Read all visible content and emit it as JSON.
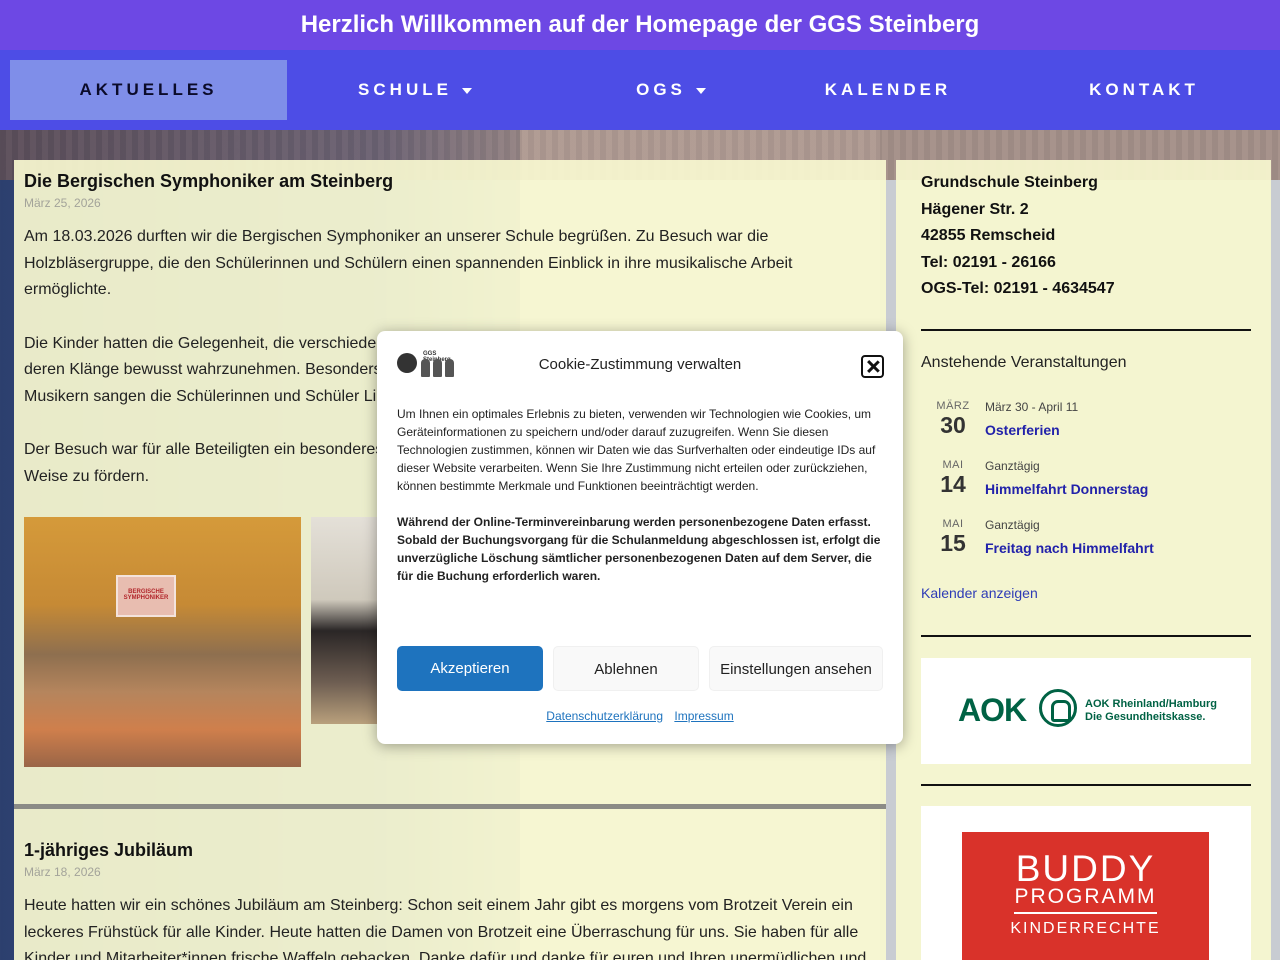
{
  "header": {
    "title": "Herzlich Willkommen auf der Homepage der GGS Steinberg"
  },
  "nav": {
    "items": [
      {
        "label": "AKTUELLES"
      },
      {
        "label": "SCHULE"
      },
      {
        "label": "OGS"
      },
      {
        "label": "KALENDER"
      },
      {
        "label": "KONTAKT"
      }
    ]
  },
  "posts": [
    {
      "title": "Die Bergischen Symphoniker am Steinberg",
      "date": "März 25, 2026",
      "paragraphs": [
        "Am 18.03.2026 durften wir die Bergischen Symphoniker an unserer Schule begrüßen. Zu Besuch war die Holzbläsergruppe, die den Schülerinnen und Schülern einen spannenden Einblick in ihre musikalische Arbeit ermöglichte.",
        "Die Kinder hatten die Gelegenheit, die verschiede",
        "deren Klänge bewusst wahrzunehmen. Besonders",
        "Musikern sangen die Schülerinnen und Schüler Li",
        "Der Besuch war für alle Beteiligten ein besonderes",
        "Weise zu fördern."
      ],
      "photo_caption": "BERGISCHE SYMPHONIKER"
    },
    {
      "title": "1-jähriges Jubiläum",
      "date": "März 18, 2026",
      "body": "Heute hatten wir ein schönes Jubiläum am Steinberg: Schon seit einem Jahr gibt es morgens vom Brotzeit Verein ein leckeres Frühstück für alle Kinder. Heute hatten die Damen von Brotzeit eine Überraschung für uns. Sie haben für alle Kinder und Mitarbeiter*innen frische Waffeln gebacken. Danke dafür und danke für euren und Ihren unermüdlichen und"
    }
  ],
  "sidebar": {
    "address": [
      "Grundschule Steinberg",
      "Hägener Str. 2",
      "42855 Remscheid",
      "Tel: 02191 - 26166",
      "OGS-Tel: 02191 - 4634547"
    ],
    "events_title": "Anstehende Veranstaltungen",
    "events": [
      {
        "month": "MÄRZ",
        "day": "30",
        "when": "März 30 - April 11",
        "name": "Osterferien"
      },
      {
        "month": "MAI",
        "day": "14",
        "when": "Ganztägig",
        "name": "Himmelfahrt Donnerstag"
      },
      {
        "month": "MAI",
        "day": "15",
        "when": "Ganztägig",
        "name": "Freitag nach Himmelfahrt"
      }
    ],
    "calendar_link": "Kalender anzeigen",
    "aok": {
      "word": "AOK",
      "line1": "AOK Rheinland/Hamburg",
      "line2": "Die Gesundheitskasse."
    },
    "buddy": {
      "line1": "BUDDY",
      "line2": "PROGRAMM",
      "line3": "KINDERRECHTE"
    }
  },
  "cookie": {
    "logo_text": "GGS Steinberg",
    "title": "Cookie-Zustimmung verwalten",
    "text": "Um Ihnen ein optimales Erlebnis zu bieten, verwenden wir Technologien wie Cookies, um Geräteinformationen zu speichern und/oder darauf zuzugreifen. Wenn Sie diesen Technologien zustimmen, können wir Daten wie das Surfverhalten oder eindeutige IDs auf dieser Website verarbeiten. Wenn Sie Ihre Zustimmung nicht erteilen oder zurückziehen, können bestimmte Merkmale und Funktionen beeinträchtigt werden.",
    "bold_text": "Während der Online-Terminvereinbarung werden personenbezogene Daten erfasst. Sobald der Buchungsvorgang für die Schulanmeldung abgeschlossen ist, erfolgt die unverzügliche Löschung sämtlicher personenbezogenen Daten auf dem Server, die für die Buchung erforderlich waren.",
    "accept": "Akzeptieren",
    "deny": "Ablehnen",
    "settings": "Einstellungen ansehen",
    "privacy_link": "Datenschutzerklärung",
    "imprint_link": "Impressum"
  },
  "colors": {
    "topbar": "#6d48e4",
    "nav": "#4d4de6",
    "accept": "#1e73be",
    "event_link": "#2222aa"
  }
}
